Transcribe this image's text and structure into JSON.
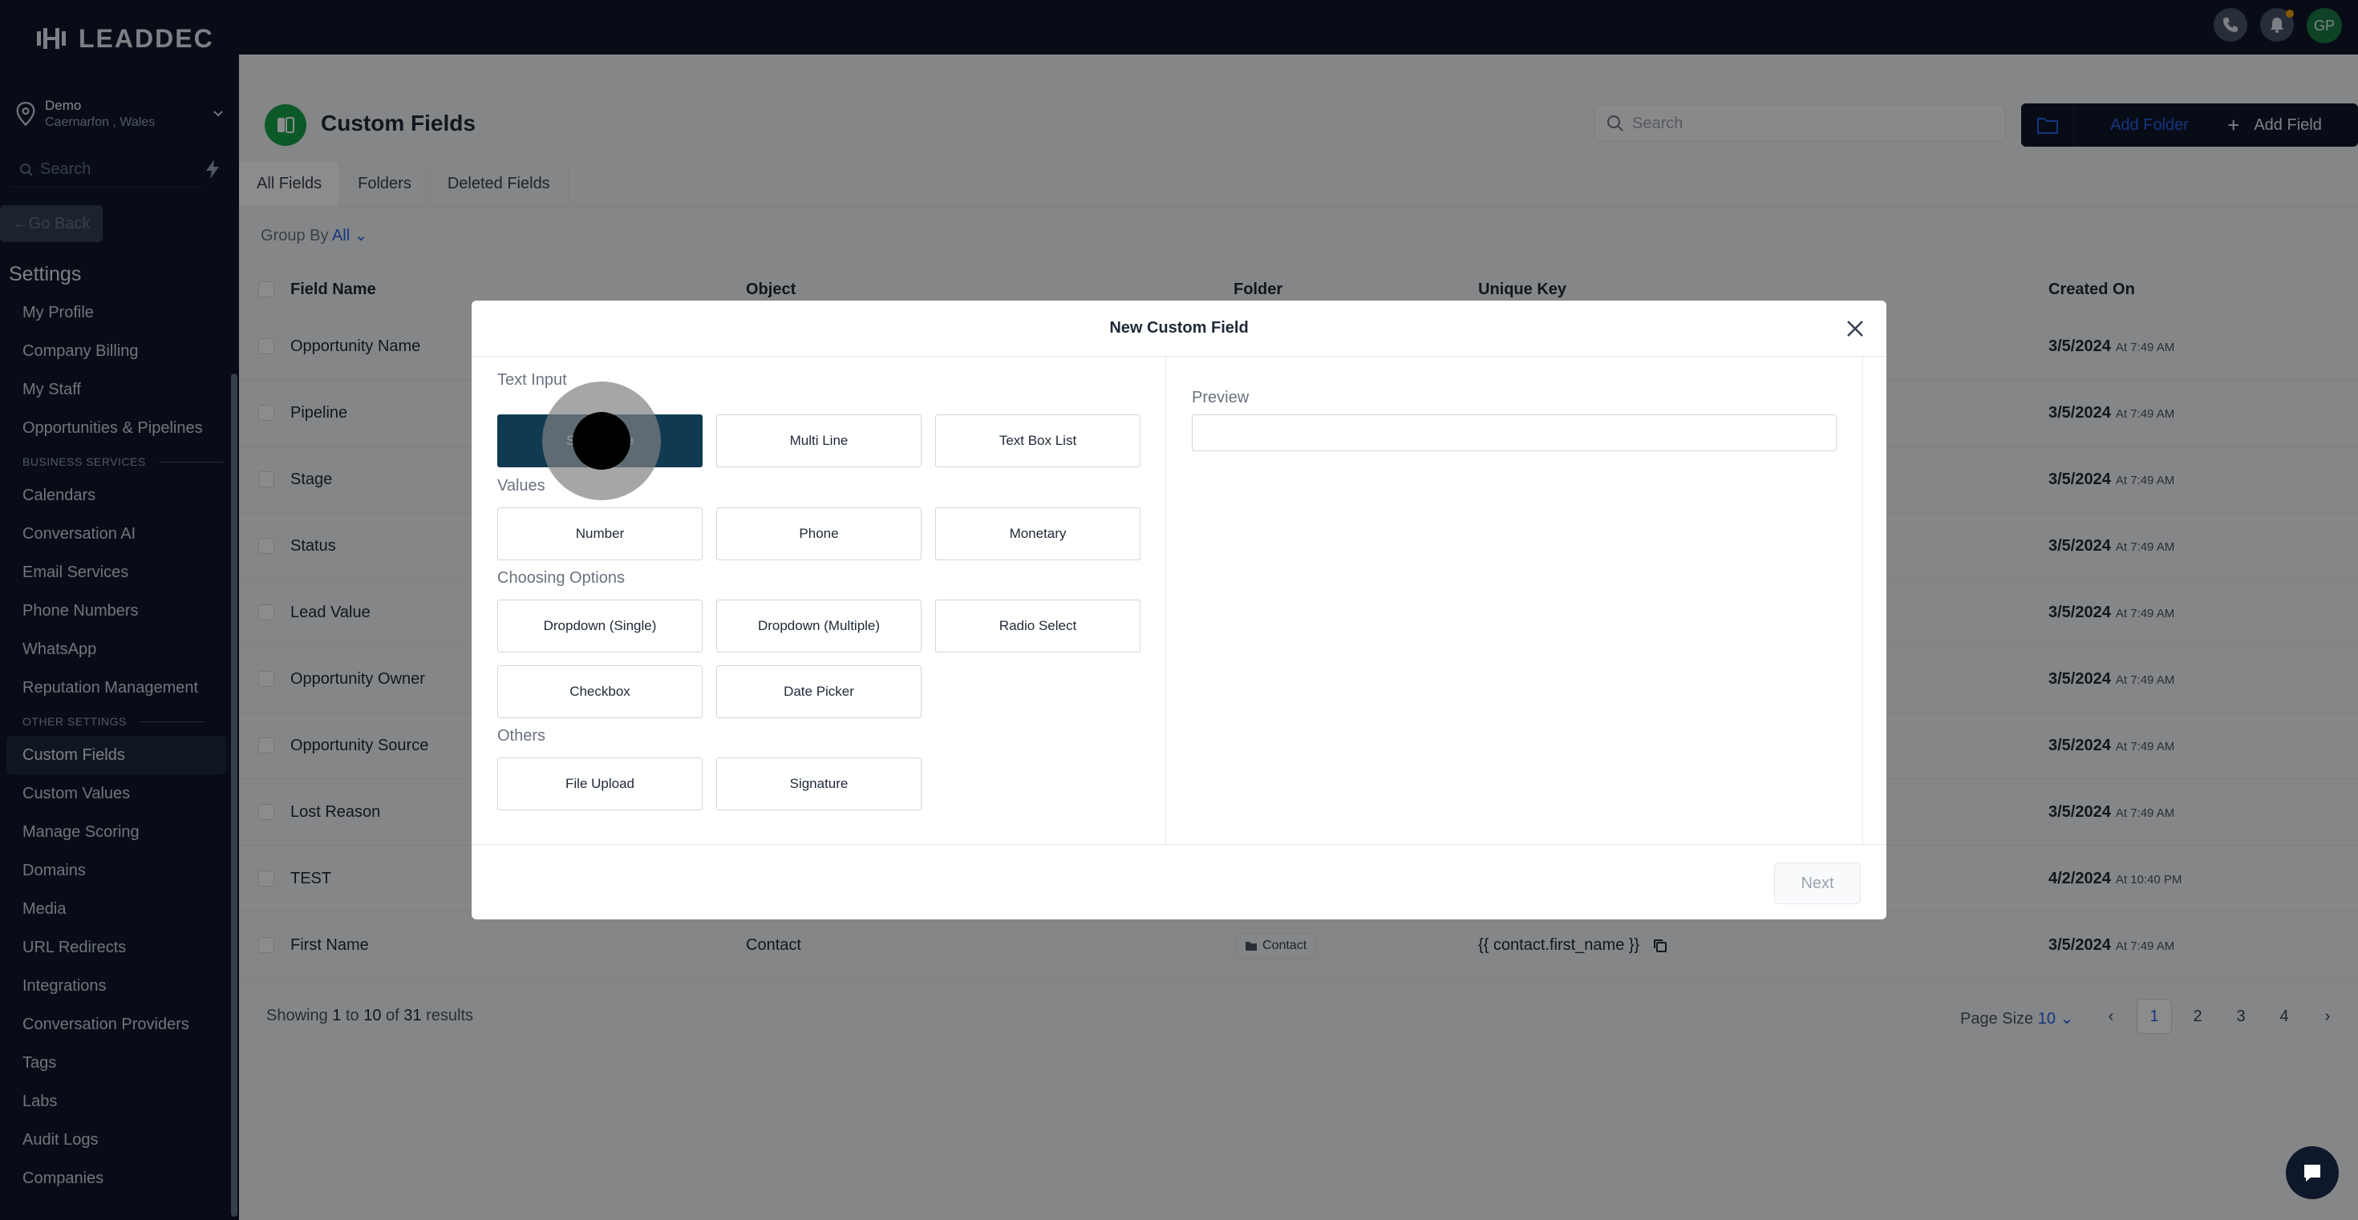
{
  "app": {
    "logo_text": "LEADDEC"
  },
  "location": {
    "name": "Demo",
    "sub": "Caernarfon , Wales"
  },
  "sidebar": {
    "search_placeholder": "Search",
    "go_back": "Go Back",
    "settings_title": "Settings",
    "items_top": [
      "My Profile",
      "Company Billing",
      "My Staff",
      "Opportunities & Pipelines"
    ],
    "section_business": "BUSINESS SERVICES",
    "items_business": [
      "Calendars",
      "Conversation AI",
      "Email Services",
      "Phone Numbers",
      "WhatsApp",
      "Reputation Management"
    ],
    "section_other": "OTHER SETTINGS",
    "items_other": [
      "Custom Fields",
      "Custom Values",
      "Manage Scoring",
      "Domains",
      "Media",
      "URL Redirects",
      "Integrations",
      "Conversation Providers",
      "Tags",
      "Labs",
      "Audit Logs",
      "Companies"
    ]
  },
  "topbar": {
    "avatar_initials": "GP"
  },
  "page": {
    "title": "Custom Fields",
    "search_placeholder": "Search",
    "add_folder": "Add Folder",
    "add_field": "Add Field",
    "tabs": [
      "All Fields",
      "Folders",
      "Deleted Fields"
    ],
    "group_by_label": "Group By",
    "group_by_value": "All"
  },
  "table": {
    "headers": [
      "Field Name",
      "Object",
      "Folder",
      "Unique Key",
      "Created On"
    ],
    "rows": [
      {
        "name": "Opportunity Name",
        "date": "3/5/2024",
        "time": "At 7:49 AM"
      },
      {
        "name": "Pipeline",
        "date": "3/5/2024",
        "time": "At 7:49 AM"
      },
      {
        "name": "Stage",
        "date": "3/5/2024",
        "time": "At 7:49 AM"
      },
      {
        "name": "Status",
        "date": "3/5/2024",
        "time": "At 7:49 AM"
      },
      {
        "name": "Lead Value",
        "date": "3/5/2024",
        "time": "At 7:49 AM"
      },
      {
        "name": "Opportunity Owner",
        "date": "3/5/2024",
        "time": "At 7:49 AM"
      },
      {
        "name": "Opportunity Source",
        "date": "3/5/2024",
        "time": "At 7:49 AM"
      },
      {
        "name": "Lost Reason",
        "date": "3/5/2024",
        "time": "At 7:49 AM"
      },
      {
        "name": "TEST",
        "date": "4/2/2024",
        "time": "At 10:40 PM"
      },
      {
        "name": "First Name",
        "object": "Contact",
        "folder": "Contact",
        "unique_key": "{{ contact.first_name }}",
        "date": "3/5/2024",
        "time": "At 7:49 AM"
      }
    ]
  },
  "footer": {
    "showing_prefix": "Showing",
    "from": "1",
    "to_word": "to",
    "to": "10",
    "of_word": "of",
    "total": "31",
    "results_word": "results",
    "page_size_label": "Page Size",
    "page_size_value": "10",
    "pages": [
      "1",
      "2",
      "3",
      "4"
    ]
  },
  "modal": {
    "title": "New Custom Field",
    "section_text_input": "Text Input",
    "section_values": "Values",
    "section_choosing": "Choosing Options",
    "section_others": "Others",
    "text_input_options": [
      "Single Line",
      "Multi Line",
      "Text Box List"
    ],
    "values_options": [
      "Number",
      "Phone",
      "Monetary"
    ],
    "choosing_options": [
      "Dropdown (Single)",
      "Dropdown (Multiple)",
      "Radio Select",
      "Checkbox",
      "Date Picker"
    ],
    "others_options": [
      "File Upload",
      "Signature"
    ],
    "preview_label": "Preview",
    "next": "Next"
  },
  "colors": {
    "sidebar_bg": "#0f172a",
    "accent_blue": "#2563eb",
    "selected_option": "#0f3a52",
    "page_icon": "#16a34a"
  }
}
